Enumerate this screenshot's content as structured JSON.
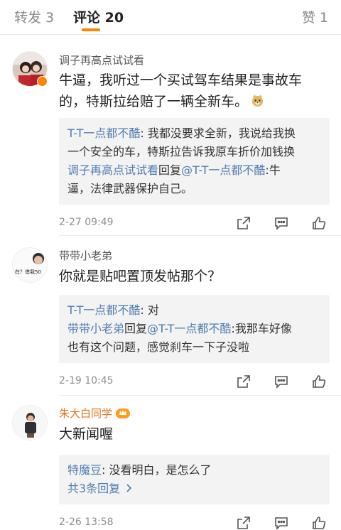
{
  "tabs": {
    "repost": "转发 3",
    "comments": "评论 20",
    "likes": "赞 1"
  },
  "comments": [
    {
      "username": "调子再高点试试看",
      "content_line1": "牛逼，我听过一个买试驾车结果是事故车",
      "content_line2": "的，特斯拉给赔了一辆全新车。",
      "emoji_icon": "doge-icon",
      "replies": {
        "r1_name": "T-T一点都不酷",
        "r1_line1": ": 我都没要求全新，我说给我换",
        "r1_line2": "一个安全的车，特斯拉告诉我原车折价加钱换",
        "r2_name": "调子再高点试试看",
        "r2_reply_word": "回复",
        "r2_mention": "@T-T一点都不酷",
        "r2_line1": ":牛",
        "r2_line2": "逼，法律武器保护自己。"
      },
      "time": "2-27 09:49"
    },
    {
      "username": "带带小老弟",
      "avatar_text": "在？借我50",
      "content": "你就是贴吧置顶发帖那个？",
      "replies": {
        "r1_name": "T-T一点都不酷",
        "r1_text": ": 对",
        "r2_name": "带带小老弟",
        "r2_reply_word": "回复",
        "r2_mention": "@T-T一点都不酷",
        "r2_line1": ":我那车好像",
        "r2_line2": "也有这个问题，感觉刹车一下子没啦"
      },
      "time": "2-19 10:45"
    },
    {
      "username": "朱大白同学",
      "content": "大新闻喔",
      "replies": {
        "r1_name": "特魔豆",
        "r1_text": ": 没看明白，是怎么了",
        "more": "共3条回复",
        "more_icon": "chevron-right-icon"
      },
      "time": "2-26 13:58"
    }
  ],
  "colors": {
    "accent": "#ff8200",
    "link": "#4f7cae",
    "vip_name": "#e3711d",
    "reply_bg": "#f3f3f3"
  },
  "icons": {
    "share": "share-icon",
    "comment": "comment-icon",
    "like": "like-icon"
  }
}
